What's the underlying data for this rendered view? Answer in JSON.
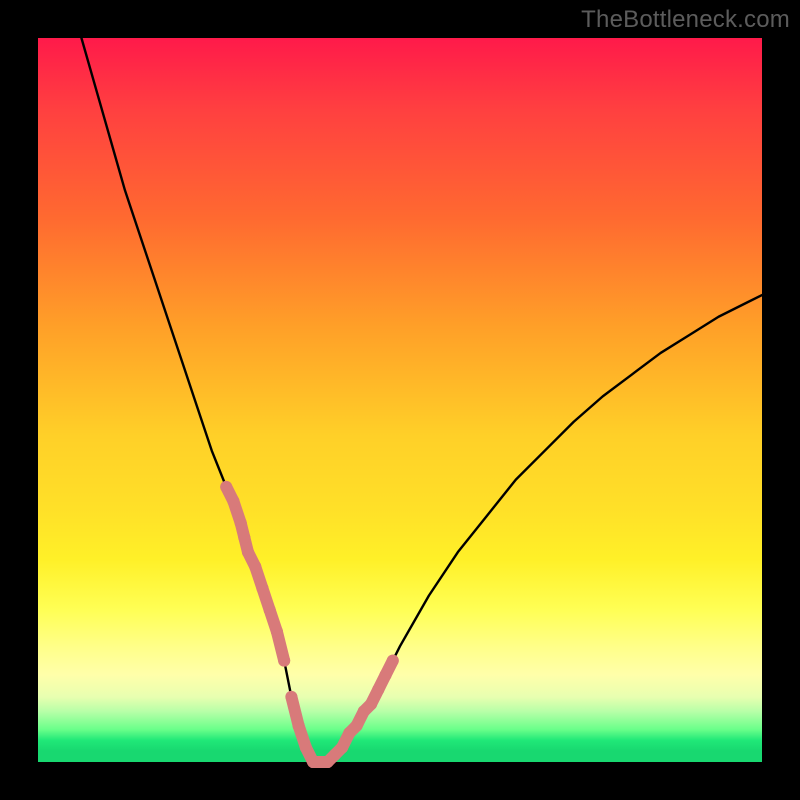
{
  "watermark": "TheBottleneck.com",
  "chart_data": {
    "type": "line",
    "title": "",
    "xlabel": "",
    "ylabel": "",
    "xlim": [
      0,
      100
    ],
    "ylim": [
      0,
      100
    ],
    "series": [
      {
        "name": "bottleneck-curve",
        "x": [
          6,
          8,
          10,
          12,
          14,
          16,
          18,
          20,
          22,
          24,
          26,
          28,
          30,
          32,
          33,
          34,
          35,
          36,
          37,
          38,
          40,
          42,
          44,
          46,
          48,
          50,
          54,
          58,
          62,
          66,
          70,
          74,
          78,
          82,
          86,
          90,
          94,
          98,
          100
        ],
        "y": [
          100,
          93,
          86,
          79,
          73,
          67,
          61,
          55,
          49,
          43,
          38,
          33,
          27,
          21,
          18,
          14,
          9,
          5,
          2,
          0,
          0,
          2,
          5,
          8,
          12,
          16,
          23,
          29,
          34,
          39,
          43,
          47,
          50.5,
          53.5,
          56.5,
          59,
          61.5,
          63.5,
          64.5
        ]
      }
    ],
    "markers": {
      "name": "highlighted-dots",
      "color": "#d87a7a",
      "x": [
        26,
        27,
        28,
        28.5,
        29,
        30,
        31,
        32,
        33,
        34,
        35,
        36,
        37,
        38,
        39,
        40,
        41,
        42,
        43,
        44,
        45,
        46,
        47,
        48,
        49
      ],
      "y": [
        38,
        36,
        33,
        31,
        29,
        27,
        24,
        21,
        18,
        14,
        9,
        5,
        2,
        0,
        0,
        0,
        1,
        2,
        4,
        5,
        7,
        8,
        10,
        12,
        14
      ]
    }
  },
  "colors": {
    "curve_stroke": "#000000",
    "marker_fill": "#d87a7a",
    "frame": "#000000"
  }
}
